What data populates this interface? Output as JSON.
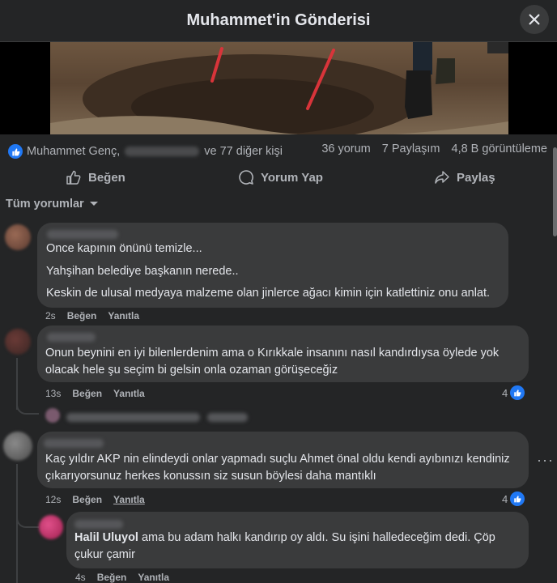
{
  "header": {
    "title": "Muhammet'in Gönderisi"
  },
  "post": {
    "reactions_author": "Muhammet Genç,",
    "reactions_others": "ve 77 diğer kişi",
    "comments_count": "36 yorum",
    "shares_count": "7 Paylaşım",
    "views_count": "4,8 B görüntüleme"
  },
  "actions": {
    "like": "Beğen",
    "comment": "Yorum Yap",
    "share": "Paylaş"
  },
  "sort": {
    "label": "Tüm yorumlar"
  },
  "comments": [
    {
      "lines": [
        "Once kapının önünü temizle...",
        "Yahşihan belediye başkanın nerede..",
        "Keskin de ulusal medyaya malzeme olan jinlerce ağacı kimin için katlettiniz onu anlat."
      ],
      "time": "2s",
      "like": "Beğen",
      "reply": "Yanıtla"
    },
    {
      "text": "Onun beynini en iyi bilenlerdenim ama o Kırıkkale insanını nasıl kandırdıysa öylede yok olacak hele şu seçim bi gelsin onla ozaman görüşeceğiz",
      "time": "13s",
      "like": "Beğen",
      "reply": "Yanıtla",
      "reaction_count": "4"
    },
    {
      "text": "Kaç yıldır AKP nin elindeydi onlar yapmadı suçlu Ahmet önal oldu kendi ayıbınızı kendiniz çıkarıyorsunuz herkes konussın siz susun böylesi daha mantıklı",
      "time": "12s",
      "like": "Beğen",
      "reply": "Yanıtla",
      "reaction_count": "4"
    }
  ],
  "reply": {
    "mention": "Halil Uluyol",
    "text": " ama bu adam halkı kandırıp oy aldı. Su işini halledeceğim dedi. Çöp çukur çamir",
    "time": "4s",
    "like": "Beğen",
    "reply": "Yanıtla"
  },
  "colors": {
    "accent": "#2078f4",
    "bg": "#242526",
    "bubble": "#3a3b3c",
    "text": "#e4e6eb",
    "muted": "#b0b3b8"
  }
}
